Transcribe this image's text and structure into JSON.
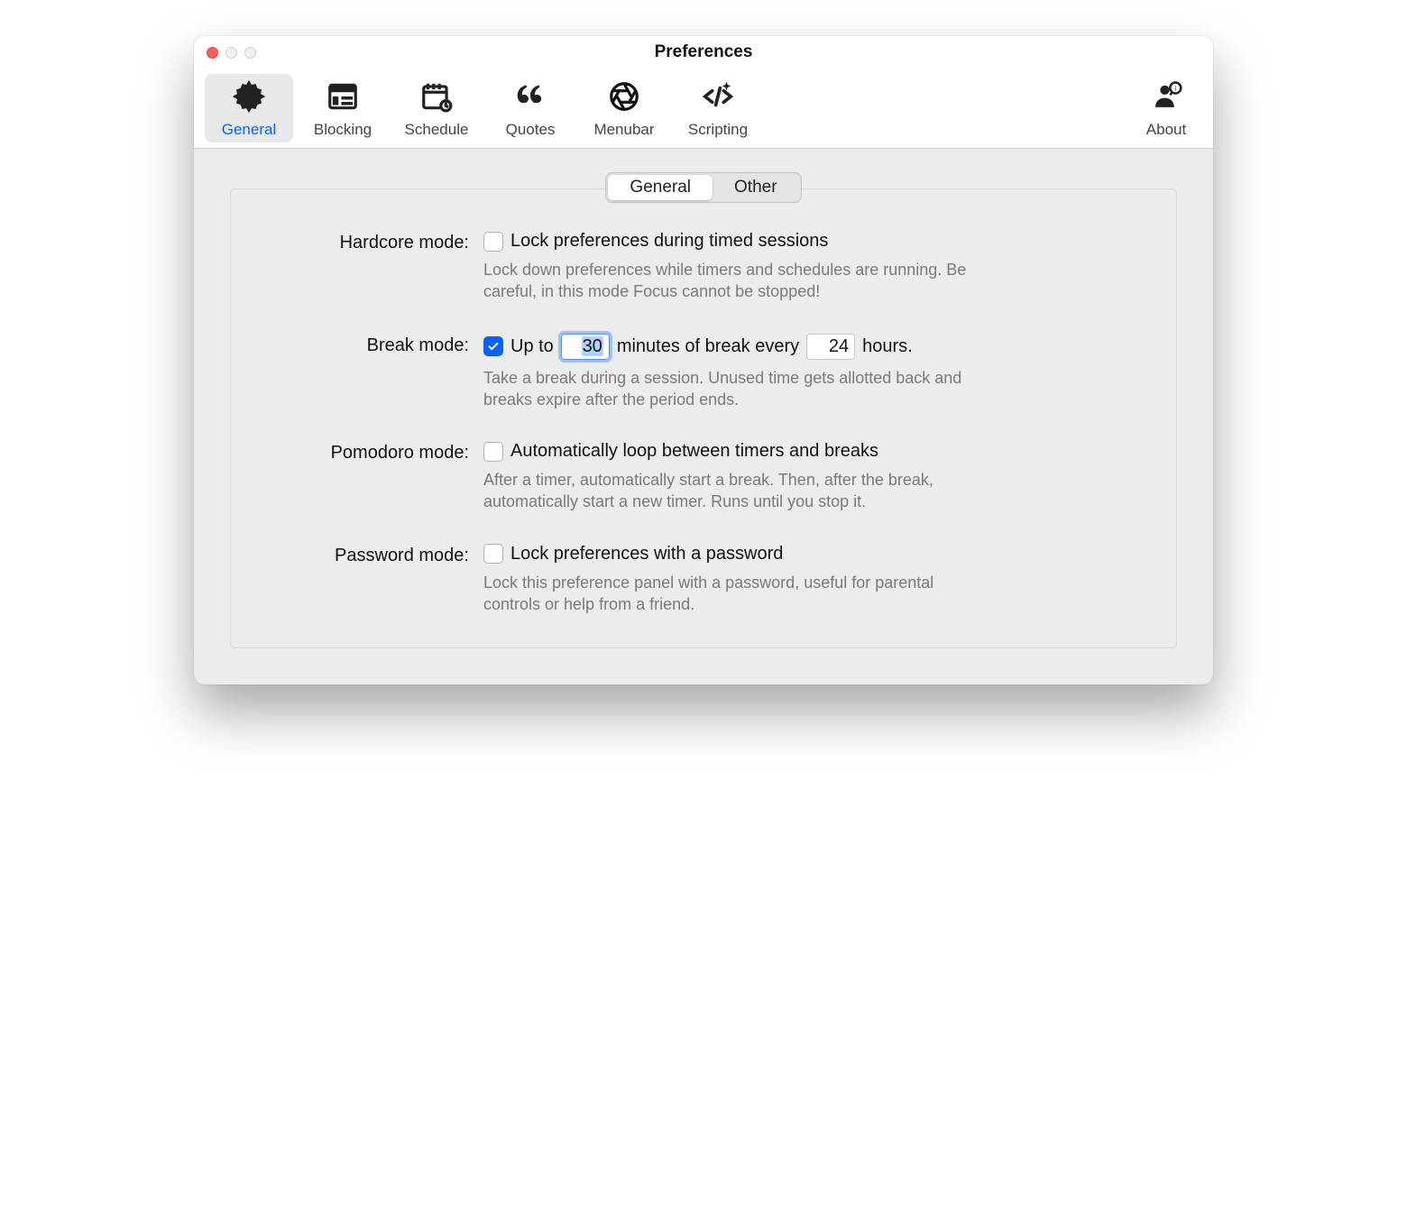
{
  "window": {
    "title": "Preferences"
  },
  "toolbar": {
    "items": [
      {
        "label": "General"
      },
      {
        "label": "Blocking"
      },
      {
        "label": "Schedule"
      },
      {
        "label": "Quotes"
      },
      {
        "label": "Menubar"
      },
      {
        "label": "Scripting"
      }
    ],
    "about": {
      "label": "About"
    },
    "selected": "General"
  },
  "segmented": {
    "tabs": [
      "General",
      "Other"
    ],
    "active": "General"
  },
  "settings": {
    "hardcore": {
      "label": "Hardcore mode:",
      "checked": false,
      "title": "Lock preferences during timed sessions",
      "desc": "Lock down preferences while timers and schedules are running. Be careful, in this mode Focus cannot be stopped!"
    },
    "break": {
      "label": "Break mode:",
      "checked": true,
      "prefix": "Up to",
      "minutes": "30",
      "mid": "minutes of break every",
      "hours": "24",
      "suffix": "hours.",
      "desc": "Take a break during a session. Unused time gets allotted back and breaks expire after the period ends."
    },
    "pomodoro": {
      "label": "Pomodoro mode:",
      "checked": false,
      "title": "Automatically loop between timers and breaks",
      "desc": "After a timer, automatically start a break. Then, after the break, automatically start a new timer. Runs until you stop it."
    },
    "password": {
      "label": "Password mode:",
      "checked": false,
      "title": "Lock preferences with a password",
      "desc": "Lock this preference panel with a password, useful for parental controls or help from a friend."
    }
  }
}
